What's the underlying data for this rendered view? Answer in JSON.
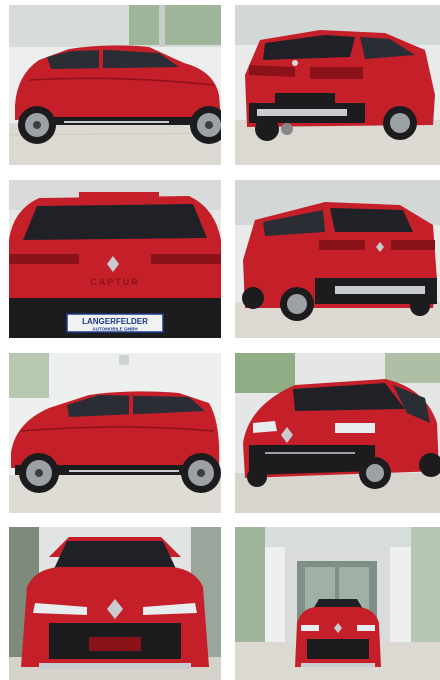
{
  "gallery": {
    "tiles": [
      {
        "view": "side-right",
        "alt": ""
      },
      {
        "view": "rear-three-quarter-left",
        "alt": ""
      },
      {
        "view": "rear",
        "alt": ""
      },
      {
        "view": "rear-three-quarter-right",
        "alt": ""
      },
      {
        "view": "side-left",
        "alt": ""
      },
      {
        "view": "front-three-quarter",
        "alt": ""
      },
      {
        "view": "front",
        "alt": ""
      },
      {
        "view": "front-showroom-far",
        "alt": ""
      }
    ],
    "rear_badge_text": "CAPTUR",
    "dealer_plate": {
      "line1": "LANGERFELDER",
      "line2": "AUTOMOBILE GMBH"
    }
  },
  "colors": {
    "car_red": "#c5202a",
    "car_dark_red": "#8c1219",
    "trim_black": "#1c1c1e",
    "chrome": "#c8ccd0",
    "floor": "#dedbd4",
    "wall": "#eef0ef",
    "glass": "#2a2d33"
  }
}
